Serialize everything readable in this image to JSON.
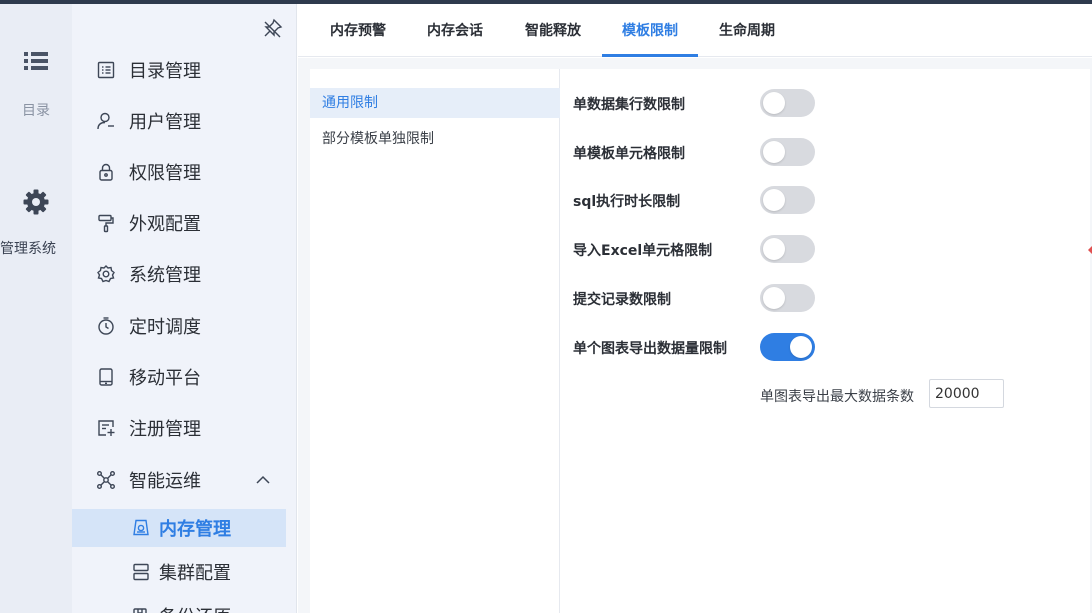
{
  "rail": {
    "catalog_label": "目录",
    "admin_label": "管理系统"
  },
  "sidebar": {
    "items": [
      {
        "label": "目录管理",
        "icon": "catalog-icon"
      },
      {
        "label": "用户管理",
        "icon": "user-icon"
      },
      {
        "label": "权限管理",
        "icon": "lock-icon"
      },
      {
        "label": "外观配置",
        "icon": "paint-roller-icon"
      },
      {
        "label": "系统管理",
        "icon": "gear-icon"
      },
      {
        "label": "定时调度",
        "icon": "timer-icon"
      },
      {
        "label": "移动平台",
        "icon": "tablet-icon"
      },
      {
        "label": "注册管理",
        "icon": "register-icon"
      },
      {
        "label": "智能运维",
        "icon": "network-icon"
      }
    ],
    "sub_items": [
      {
        "label": "内存管理",
        "icon": "memory-icon"
      },
      {
        "label": "集群配置",
        "icon": "server-icon"
      },
      {
        "label": "备份还原",
        "icon": "backup-icon"
      }
    ]
  },
  "tabs": [
    "内存预警",
    "内存会话",
    "智能释放",
    "模板限制",
    "生命周期"
  ],
  "active_tab": "模板限制",
  "list": [
    "通用限制",
    "部分模板单独限制"
  ],
  "settings": [
    {
      "label": "单数据集行数限制",
      "enabled": false
    },
    {
      "label": "单模板单元格限制",
      "enabled": false
    },
    {
      "label": "sql执行时长限制",
      "enabled": false
    },
    {
      "label": "导入Excel单元格限制",
      "enabled": false
    },
    {
      "label": "提交记录数限制",
      "enabled": false
    },
    {
      "label": "单个图表导出数据量限制",
      "enabled": true
    }
  ],
  "max_export": {
    "label": "单图表导出最大数据条数",
    "value": "20000"
  },
  "colors": {
    "accent": "#2f7ee3",
    "toggle_off": "#d8dadf",
    "rail_bg": "#e9edf5",
    "sidebar_bg": "#f0f3fa"
  }
}
